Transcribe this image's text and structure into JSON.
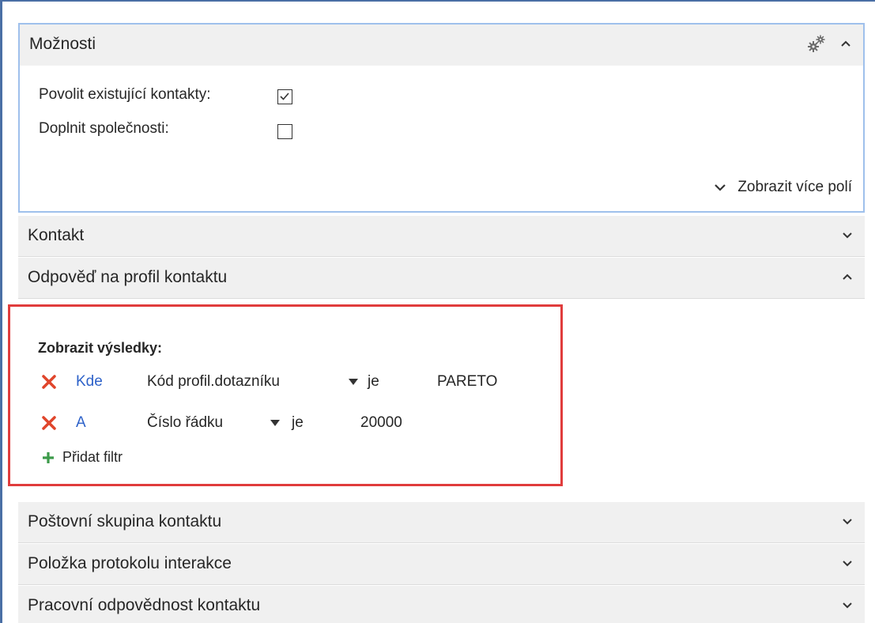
{
  "options": {
    "title": "Možnosti",
    "rows": [
      {
        "label": "Povolit existující kontakty:",
        "checked": true
      },
      {
        "label": "Doplnit společnosti:",
        "checked": false
      }
    ],
    "more_fields": "Zobrazit více polí"
  },
  "sections": {
    "contact": "Kontakt",
    "profile_answer": "Odpověď na profil kontaktu",
    "mail_group": "Poštovní skupina kontaktu",
    "interaction_log": "Položka protokolu interakce",
    "job_responsibility": "Pracovní odpovědnost kontaktu"
  },
  "filters": {
    "title": "Zobrazit výsledky:",
    "rows": [
      {
        "keyword": "Kde",
        "field": "Kód profil.dotazníku",
        "operator": "je",
        "value": "PARETO"
      },
      {
        "keyword": "A",
        "field": "Číslo řádku",
        "operator": "je",
        "value": "20000"
      }
    ],
    "add_label": "Přidat filtr"
  },
  "colors": {
    "accent_blue": "#2e62c9",
    "remove_red": "#e0452b",
    "add_green": "#3c9a4a",
    "highlight_border": "#e03c3c",
    "focus_border": "#9fc0ec"
  }
}
